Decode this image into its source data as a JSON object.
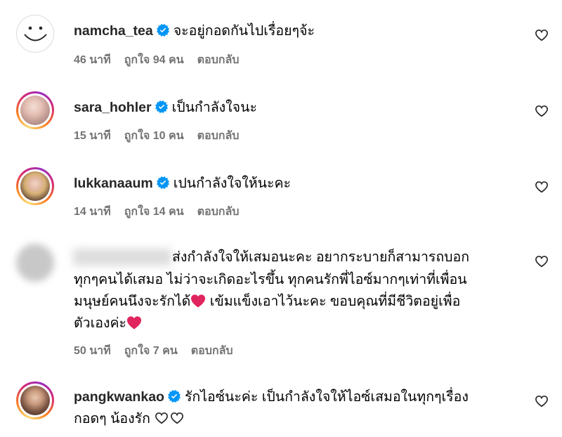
{
  "comments": [
    {
      "username": "namcha_tea",
      "verified": true,
      "text": "จะอยู่กอดกันไปเรื่อยๆจ้ะ",
      "time": "46 นาที",
      "likes": "ถูกใจ 94 คน",
      "reply": "ตอบกลับ",
      "avatar": "smiley-avatar"
    },
    {
      "username": "sara_hohler",
      "verified": true,
      "text": "เป็นกำลังใจนะ",
      "time": "15 นาที",
      "likes": "ถูกใจ 10 คน",
      "reply": "ตอบกลับ",
      "avatar": "photo-avatar"
    },
    {
      "username": "lukkanaaum",
      "verified": true,
      "text": "เปนกำลังใจให้นะคะ",
      "time": "14 นาที",
      "likes": "ถูกใจ 14 คน",
      "reply": "ตอบกลับ",
      "avatar": "photo-avatar"
    },
    {
      "username": "",
      "verified": false,
      "text_lines": [
        "ส่งกำลังใจให้เสมอนะคะ อยากระบายก็สามารถบอก",
        "ทุกๆคนได้เสมอ ไม่ว่าจะเกิดอะไรขึ้น ทุกคนรักพี่ไอซ์มากๆเท่าที่เพื่อน",
        "มนุษย์คนนึงจะรักได้",
        "เข้มแข็งเอาไว้นะคะ ขอบคุณที่มีชีวิตอยู่เพื่อ",
        "ตัวเองค่ะ"
      ],
      "time": "50 นาที",
      "likes": "ถูกใจ 7 คน",
      "reply": "ตอบกลับ",
      "avatar": "blurred-avatar"
    },
    {
      "username": "pangkwankao",
      "verified": true,
      "text_lines": [
        "รักไอซ์นะค่ะ เป็นกำลังใจให้ไอซ์เสมอในทุกๆเรื่อง",
        "กอดๆ น้องรัก"
      ],
      "avatar": "photo-avatar"
    }
  ],
  "icons": {
    "like": "heart-outline-icon",
    "verified": "verified-badge-icon",
    "emoji_heart": "red-heart-emoji"
  },
  "colors": {
    "verified": "#0095f6",
    "meta": "#737373",
    "heart_red": "#e0245e"
  }
}
